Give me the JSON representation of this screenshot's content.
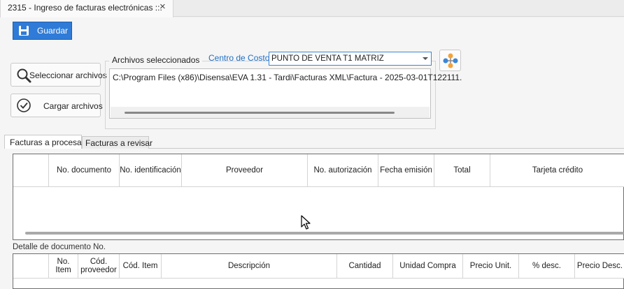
{
  "window_tab": {
    "title": "2315 - Ingreso de facturas electrónicas ::.",
    "close_glyph": "×"
  },
  "toolbar": {
    "save_label": "Guardar",
    "save_icon": "floppy-disk-icon"
  },
  "actions": {
    "select_files_label": "Seleccionar archivos",
    "select_files_icon": "magnifier-icon",
    "load_files_label": "Cargar archivos",
    "load_files_icon": "check-circle-icon"
  },
  "files_group": {
    "title": "Archivos seleccionados",
    "items": [
      "C:\\Program Files (x86)\\Disensa\\EVA 1.31 - Tardi\\Facturas XML\\Factura - 2025-03-01T122111."
    ]
  },
  "cost_center": {
    "label": "Centro de Costo:",
    "selected": "PUNTO DE VENTA T1 MATRIZ"
  },
  "org_button": {
    "icon": "org-structure-icon"
  },
  "tabs": [
    {
      "label": "Facturas a procesar",
      "active": true
    },
    {
      "label": "Facturas a revisar",
      "active": false
    }
  ],
  "invoices_grid": {
    "columns": [
      "",
      "No. documento",
      "No. identificación",
      "Proveedor",
      "No. autorización",
      "Fecha emisión",
      "Total",
      "Tarjeta crédito"
    ],
    "rows": []
  },
  "detail": {
    "label": "Detalle de documento No.",
    "columns": [
      "",
      "No. Item",
      "Cód. proveedor",
      "Cód. Item",
      "Descripción",
      "Cantidad",
      "Unidad Compra",
      "Precio Unit.",
      "% desc.",
      "Precio Desc."
    ],
    "rows": []
  },
  "colors": {
    "accent": "#2f7bd7",
    "link": "#1f6fc6",
    "grid_border": "#6e6e6e"
  }
}
